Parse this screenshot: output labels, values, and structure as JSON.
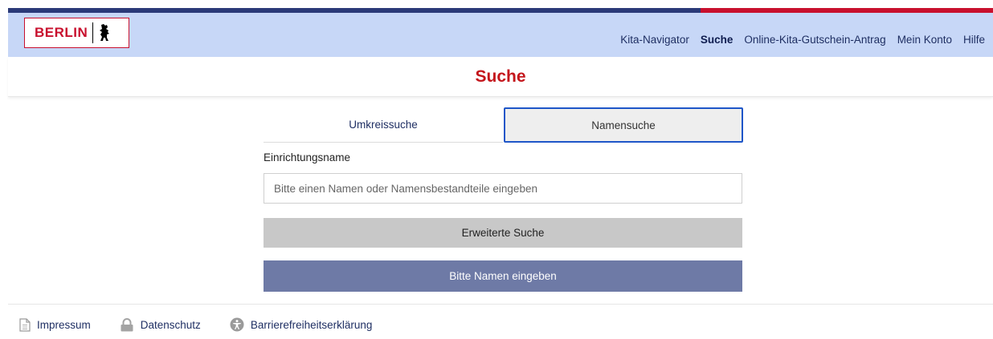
{
  "header": {
    "logo_text": "BERLIN",
    "nav": [
      {
        "label": "Kita-Navigator",
        "active": false
      },
      {
        "label": "Suche",
        "active": true
      },
      {
        "label": "Online-Kita-Gutschein-Antrag",
        "active": false
      },
      {
        "label": "Mein Konto",
        "active": false
      },
      {
        "label": "Hilfe",
        "active": false
      }
    ]
  },
  "page": {
    "title": "Suche"
  },
  "search": {
    "tabs": [
      {
        "label": "Umkreissuche",
        "selected": false
      },
      {
        "label": "Namensuche",
        "selected": true
      }
    ],
    "field_label": "Einrichtungsname",
    "placeholder": "Bitte einen Namen oder Namensbestandteile eingeben",
    "value": "",
    "extended_button": "Erweiterte Suche",
    "submit_button": "Bitte Namen eingeben"
  },
  "footer": {
    "links": [
      {
        "label": "Impressum",
        "icon": "document-icon"
      },
      {
        "label": "Datenschutz",
        "icon": "lock-icon"
      },
      {
        "label": "Barrierefreiheitserklärung",
        "icon": "accessibility-icon"
      }
    ]
  },
  "colors": {
    "accent_red": "#c4161c",
    "nav_blue": "#2b3a78",
    "header_bg": "#c7d7f7",
    "submit_bg": "#6e7aa6",
    "tab_focus": "#1e56c8"
  }
}
